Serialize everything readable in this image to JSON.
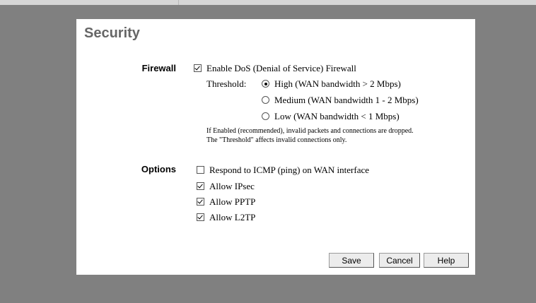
{
  "page": {
    "title": "Security"
  },
  "firewall": {
    "label": "Firewall",
    "enable_dos": {
      "label": "Enable DoS (Denial of Service) Firewall",
      "checked": true
    },
    "threshold_label": "Threshold:",
    "options": [
      {
        "label": "High (WAN bandwidth > 2 Mbps)",
        "selected": true
      },
      {
        "label": "Medium (WAN bandwidth 1 - 2 Mbps)",
        "selected": false
      },
      {
        "label": "Low (WAN bandwidth < 1 Mbps)",
        "selected": false
      }
    ],
    "note_line1": "If Enabled (recommended), invalid packets and connections are dropped.",
    "note_line2": "The \"Threshold\" affects invalid connections only."
  },
  "options": {
    "label": "Options",
    "items": [
      {
        "label": "Respond to ICMP (ping) on WAN interface",
        "checked": false
      },
      {
        "label": "Allow IPsec",
        "checked": true
      },
      {
        "label": "Allow PPTP",
        "checked": true
      },
      {
        "label": "Allow L2TP",
        "checked": true
      }
    ]
  },
  "buttons": {
    "save": "Save",
    "cancel": "Cancel",
    "help": "Help"
  }
}
